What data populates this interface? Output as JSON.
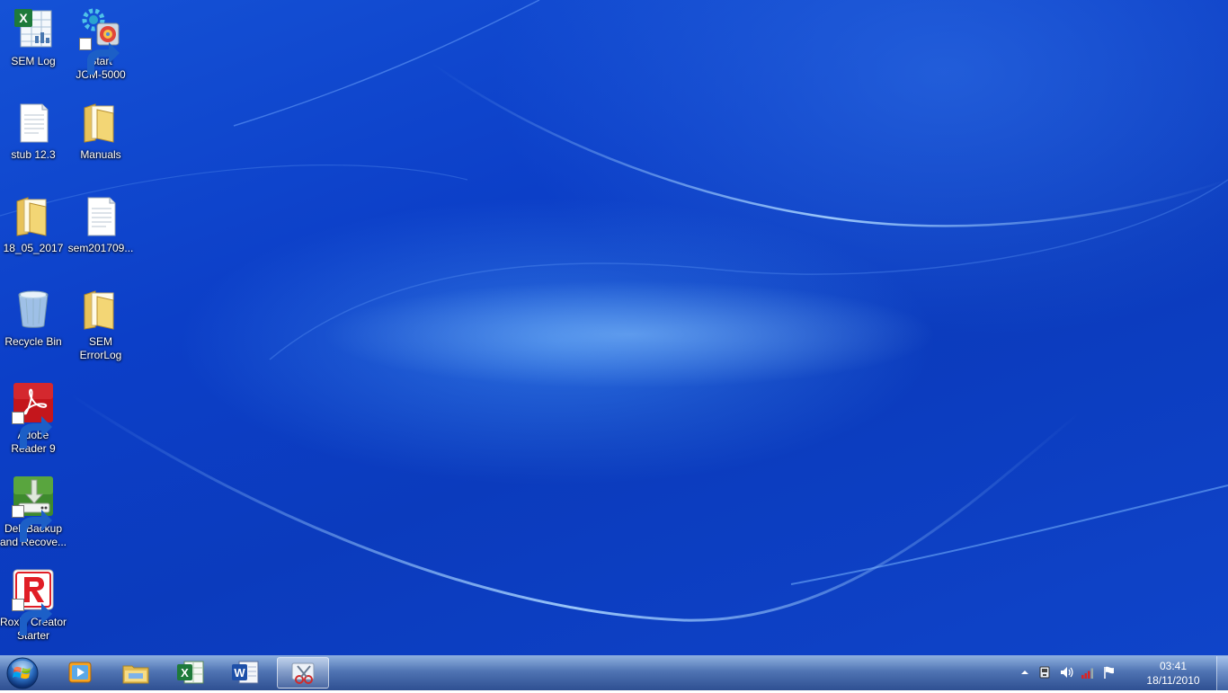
{
  "desktop": {
    "icons": [
      {
        "id": "sem-log",
        "label": "SEM Log",
        "icon": "excel-spreadsheet-icon",
        "shortcut": false
      },
      {
        "id": "start-jcm",
        "label": "Start\nJCM-5000",
        "icon": "gear-app-icon",
        "shortcut": true
      },
      {
        "id": "stub",
        "label": "stub 12.3",
        "icon": "text-document-icon",
        "shortcut": false
      },
      {
        "id": "manuals",
        "label": "Manuals",
        "icon": "folder-icon",
        "shortcut": false
      },
      {
        "id": "folder-date",
        "label": "18_05_2017",
        "icon": "folder-icon",
        "shortcut": false
      },
      {
        "id": "sem-file",
        "label": "sem201709...",
        "icon": "text-document-icon",
        "shortcut": false
      },
      {
        "id": "recycle-bin",
        "label": "Recycle Bin",
        "icon": "recycle-bin-icon",
        "shortcut": false
      },
      {
        "id": "sem-errorlog",
        "label": "SEM ErrorLog",
        "icon": "folder-icon",
        "shortcut": false
      },
      {
        "id": "adobe-reader",
        "label": "Adobe\nReader 9",
        "icon": "adobe-reader-icon",
        "shortcut": true
      },
      {
        "id": "dell-backup",
        "label": "Dell Backup\nand Recove...",
        "icon": "dell-backup-icon",
        "shortcut": true
      },
      {
        "id": "roxio",
        "label": "Roxio Creator\nStarter",
        "icon": "roxio-icon",
        "shortcut": true
      }
    ]
  },
  "taskbar": {
    "start": {
      "icon": "windows-start-orb-icon"
    },
    "pinned": [
      {
        "id": "media-player",
        "icon": "media-player-icon"
      },
      {
        "id": "explorer",
        "icon": "file-explorer-icon"
      },
      {
        "id": "excel",
        "icon": "excel-icon"
      },
      {
        "id": "word",
        "icon": "word-icon"
      },
      {
        "id": "snipping-tool",
        "icon": "snipping-tool-icon",
        "active": true
      }
    ],
    "tray": {
      "icons": [
        "show-hidden-icons-icon",
        "network-adapter-icon",
        "volume-icon",
        "signal-bars-icon",
        "action-center-flag-icon"
      ],
      "clock": {
        "time": "03:41",
        "date": "18/11/2010"
      }
    }
  },
  "colors": {
    "desktop_blue": "#0c3fc8",
    "label_text": "#ffffff"
  }
}
